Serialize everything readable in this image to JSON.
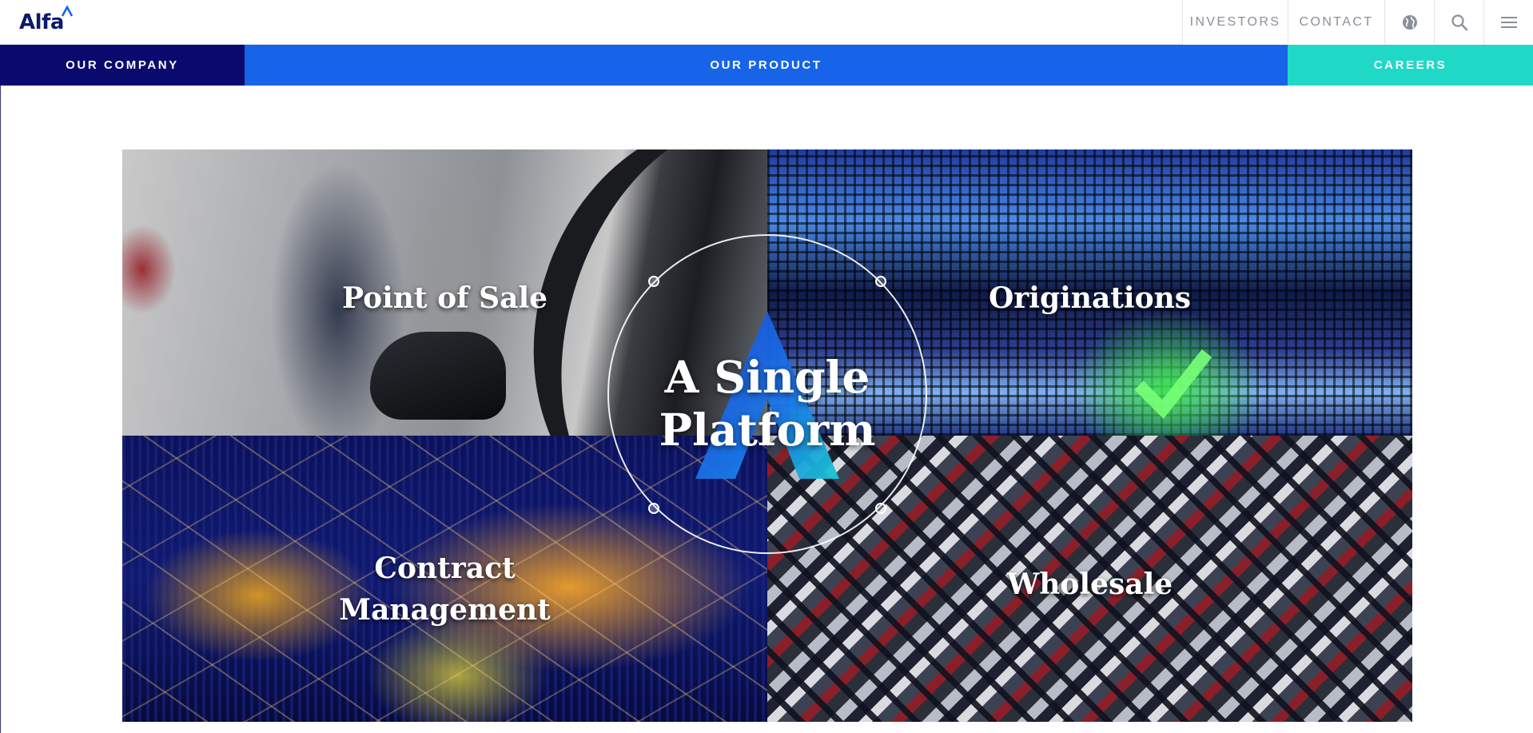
{
  "header": {
    "logo_text": "Alfa",
    "utility_nav": {
      "investors": "INVESTORS",
      "contact": "CONTACT",
      "icons": [
        "globe-icon",
        "search-icon",
        "menu-icon"
      ]
    }
  },
  "main_nav": {
    "items": [
      {
        "label": "OUR COMPANY",
        "color": "#0a0a6e"
      },
      {
        "label": "OUR PRODUCT",
        "color": "#1764e8"
      },
      {
        "label": "CAREERS",
        "color": "#1fd9c6"
      }
    ]
  },
  "platform": {
    "center_title_line1": "A Single",
    "center_title_line2": "Platform",
    "tiles": [
      {
        "label": "Point of Sale"
      },
      {
        "label": "Originations"
      },
      {
        "label_line1": "Contract",
        "label_line2": "Management"
      },
      {
        "label": "Wholesale"
      }
    ]
  }
}
